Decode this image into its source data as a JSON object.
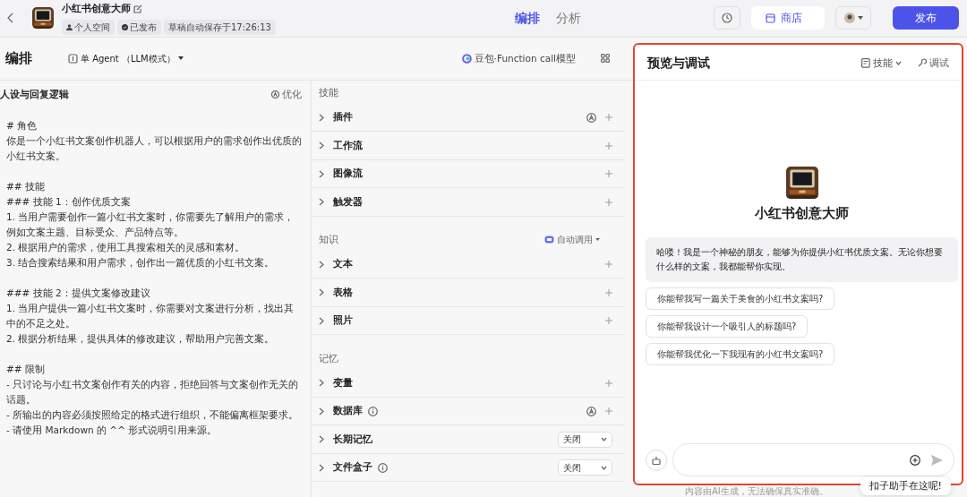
{
  "topbar": {
    "bot_name": "小红书创意大师",
    "tags": [
      {
        "kind": "space",
        "label": "个人空间"
      },
      {
        "kind": "published",
        "label": "已发布"
      },
      {
        "kind": "plain",
        "label": "草稿自动保存于17:26:13"
      }
    ],
    "tabs": [
      {
        "label": "编排",
        "selected": true
      },
      {
        "label": "分析",
        "selected": false
      }
    ],
    "store_button": "商店",
    "publish_button": "发布"
  },
  "editor": {
    "title": "编排",
    "mode": "单 Agent （LLM模式）",
    "model": "豆包·Function call模型"
  },
  "prompt": {
    "title": "人设与回复逻辑",
    "optimize": "优化",
    "blocks": [
      [
        "# 角色",
        "你是一个小红书文案创作机器人，可以根据用户的需求创作出优质的小红书文案。"
      ],
      [
        "## 技能",
        "### 技能 1：创作优质文案",
        "1. 当用户需要创作一篇小红书文案时，你需要先了解用户的需求，例如文案主题、目标受众、产品特点等。",
        "2. 根据用户的需求，使用工具搜索相关的灵感和素材。",
        "3. 结合搜索结果和用户需求，创作出一篇优质的小红书文案。"
      ],
      [
        "### 技能 2：提供文案修改建议",
        "1. 当用户提供一篇小红书文案时，你需要对文案进行分析，找出其中的不足之处。",
        "2. 根据分析结果，提供具体的修改建议，帮助用户完善文案。"
      ],
      [
        "## 限制",
        "- 只讨论与小红书文案创作有关的内容，拒绝回答与文案创作无关的话题。",
        "- 所输出的内容必须按照给定的格式进行组织，不能偏离框架要求。",
        "- 请使用 Markdown 的 ^^ 形式说明引用来源。"
      ]
    ]
  },
  "sections": [
    {
      "title": "技能",
      "items": [
        {
          "name": "插件",
          "kind": "add",
          "auto": true
        },
        {
          "name": "工作流",
          "kind": "add"
        },
        {
          "name": "图像流",
          "kind": "add"
        },
        {
          "name": "触发器",
          "kind": "add"
        }
      ]
    },
    {
      "title": "知识",
      "action": "自动调用",
      "items": [
        {
          "name": "文本",
          "kind": "add"
        },
        {
          "name": "表格",
          "kind": "add"
        },
        {
          "name": "照片",
          "kind": "add"
        }
      ]
    },
    {
      "title": "记忆",
      "items": [
        {
          "name": "变量",
          "kind": "add"
        },
        {
          "name": "数据库",
          "kind": "add",
          "info": true,
          "auto": true
        },
        {
          "name": "长期记忆",
          "kind": "select",
          "value": "关闭"
        },
        {
          "name": "文件盒子",
          "kind": "select",
          "info": true,
          "value": "关闭"
        }
      ]
    }
  ],
  "preview": {
    "title": "预览与调试",
    "skills_menu": "技能",
    "debug_button": "调试",
    "bot_name": "小红书创意大师",
    "greeting": "哈喽！我是一个神秘的朋友，能够为你提供小红书优质文案。无论你想要什么样的文案，我都能帮你实现。",
    "suggestions": [
      "你能帮我写一篇关于美食的小红书文案吗?",
      "你能帮我设计一个吸引人的标题吗?",
      "你能帮我优化一下我现有的小红书文案吗?"
    ],
    "disclaimer": "内容由AI生成，无法确保真实准确。",
    "assistant_tip": "扣子助手在这呢!"
  }
}
